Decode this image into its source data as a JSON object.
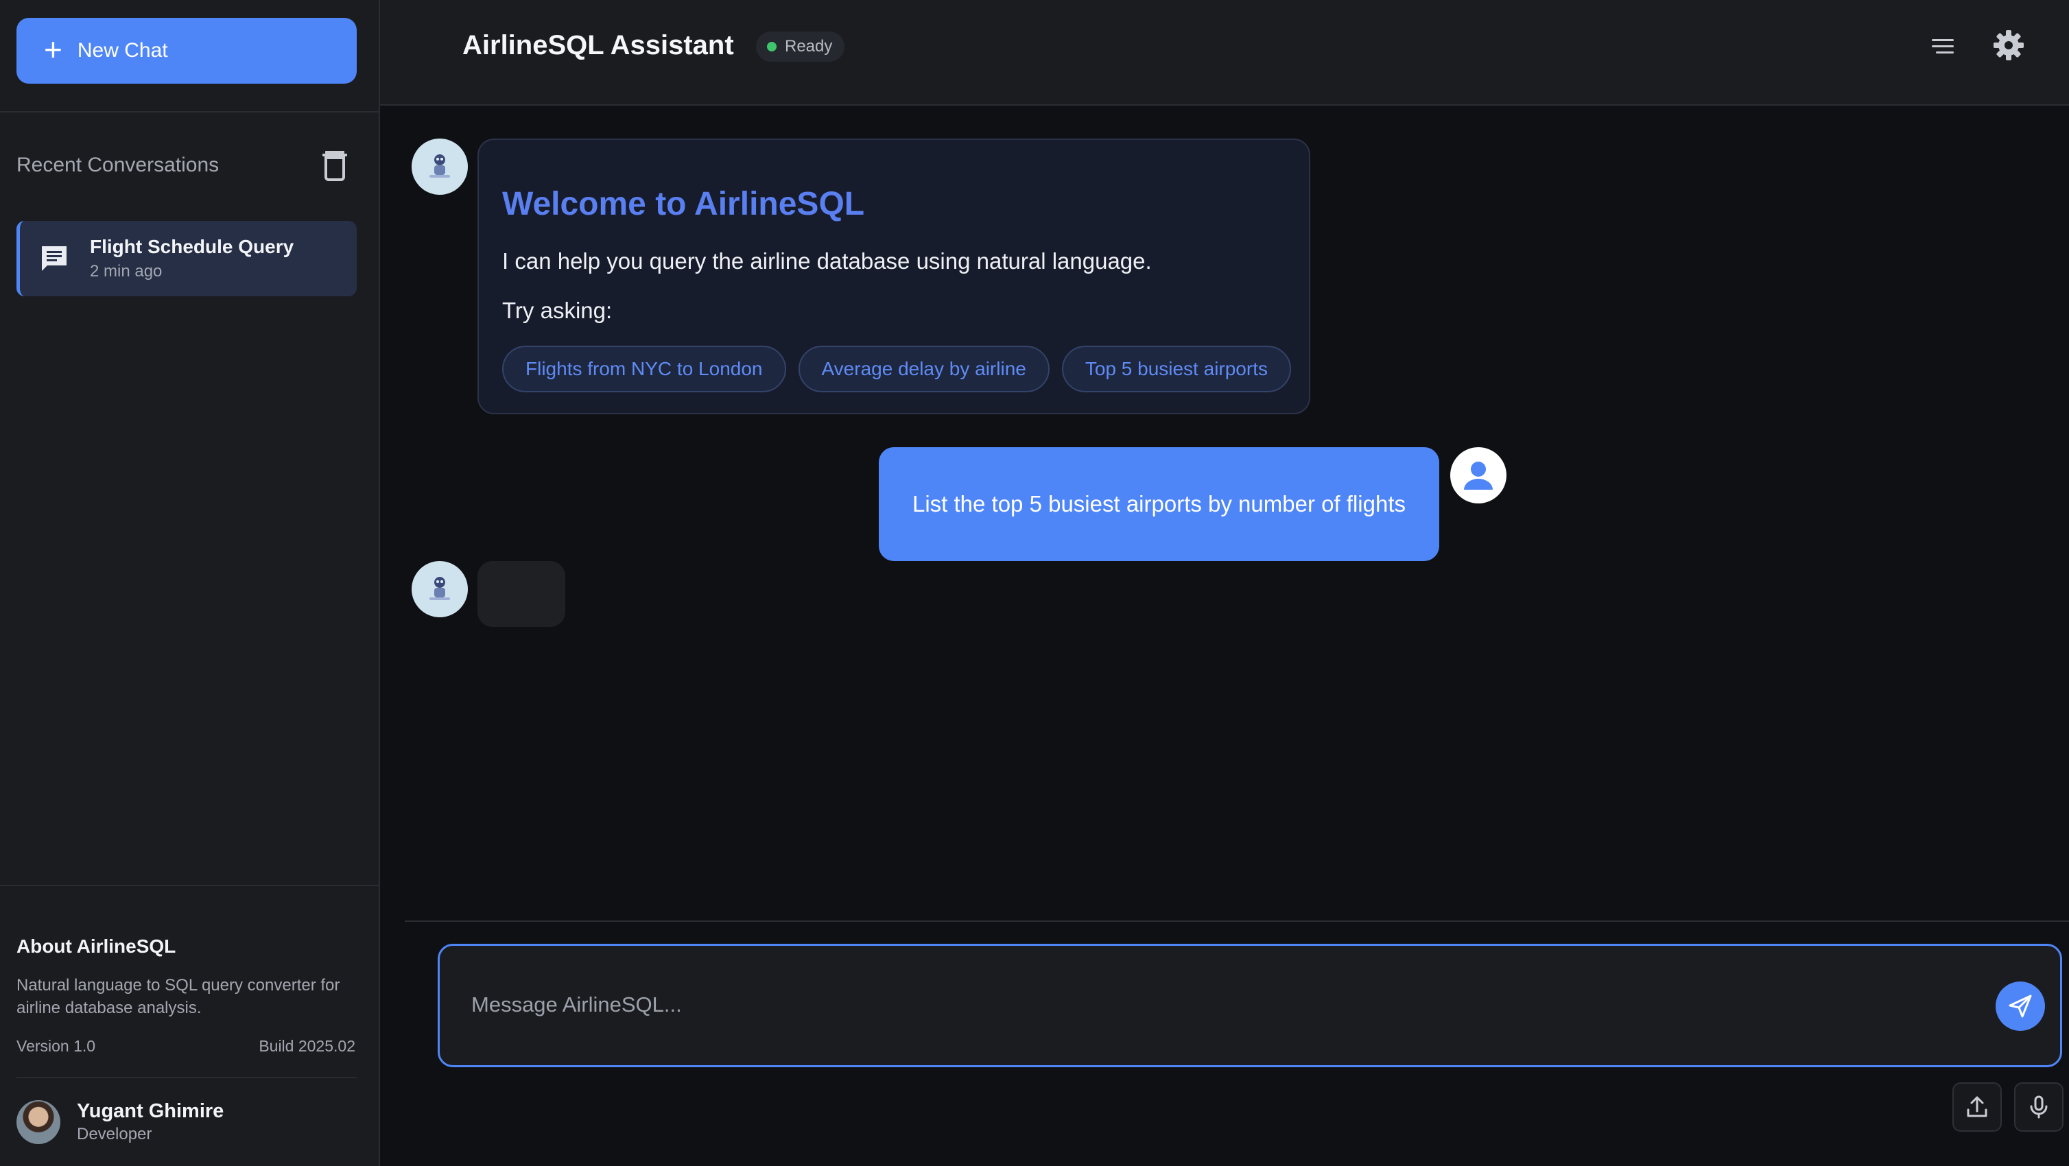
{
  "sidebar": {
    "new_chat_label": "New Chat",
    "recent_heading": "Recent Conversations",
    "conversations": [
      {
        "title": "Flight Schedule Query",
        "time": "2 min ago"
      }
    ],
    "about": {
      "title": "About AirlineSQL",
      "description": "Natural language to SQL query converter for airline database analysis.",
      "version": "Version 1.0",
      "build": "Build 2025.02"
    },
    "user": {
      "name": "Yugant Ghimire",
      "role": "Developer"
    }
  },
  "header": {
    "title": "AirlineSQL Assistant",
    "status": "Ready",
    "status_color": "#3ec46d"
  },
  "chat": {
    "welcome": {
      "title": "Welcome to AirlineSQL",
      "text": "I can help you query the airline database using natural language.",
      "try_asking": "Try asking:",
      "suggestions": [
        "Flights from NYC to London",
        "Average delay by airline",
        "Top 5 busiest airports"
      ]
    },
    "user_message": "List the top 5 busiest airports by number of flights"
  },
  "composer": {
    "placeholder": "Message AirlineSQL..."
  },
  "colors": {
    "accent": "#4f86f7",
    "title_accent": "#5a7ff0",
    "background": "#0f1013",
    "panel": "#1b1c20"
  },
  "icons": {
    "new_chat": "plus-icon",
    "clear": "trash-icon",
    "conversation": "chat-bubble-icon",
    "menu": "menu-lines-icon",
    "settings": "gear-icon",
    "send": "send-icon",
    "upload": "upload-icon",
    "voice": "microphone-icon"
  }
}
